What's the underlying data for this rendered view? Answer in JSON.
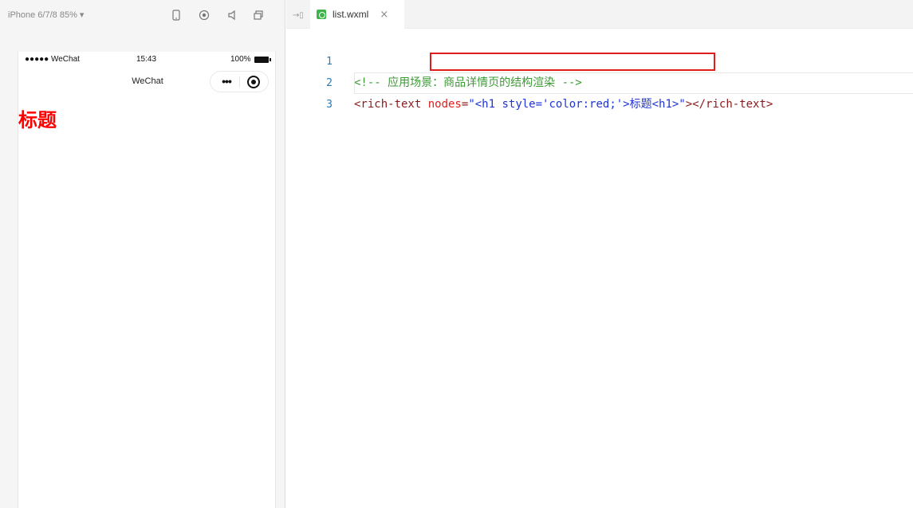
{
  "simulator": {
    "device_label": "iPhone 6/7/8 85% ▾",
    "status": {
      "signal": "●●●●● WeChat",
      "time": "15:43",
      "battery": "100%"
    },
    "nav_title": "WeChat",
    "capsule_dots": "•••",
    "rendered_heading": "标题"
  },
  "editor": {
    "tab": {
      "label": "list.wxml",
      "close": "×"
    },
    "lines": [
      {
        "num": "1",
        "comment": "<!-- 应用场景：商品详情页的结构渲染 -->"
      },
      {
        "num": "2",
        "tag_open": "<rich-text ",
        "attr_name": "nodes",
        "attr_eq": "=",
        "attr_value_a": "\"<h1 style='color:red;'>",
        "attr_value_b": "标题",
        "attr_value_c": "<h1>\"",
        "tag_close": "></rich-text>"
      },
      {
        "num": "3"
      }
    ]
  },
  "colors": {
    "highlight_box": "#e01c1c",
    "rendered_heading": "#ff0000"
  }
}
